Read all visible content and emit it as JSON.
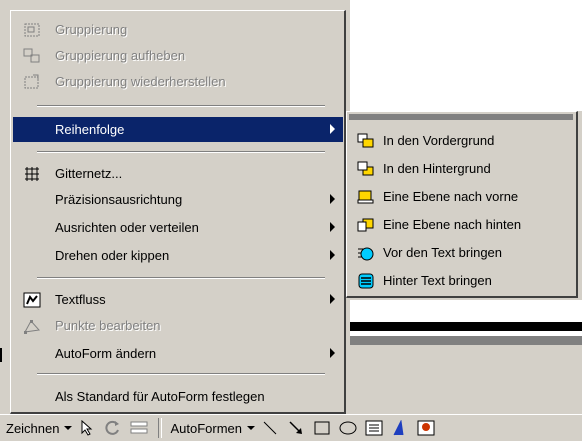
{
  "menu": {
    "items": [
      {
        "label": "Gruppierung",
        "icon": "group-icon",
        "disabled": true
      },
      {
        "label": "Gruppierung aufheben",
        "icon": "ungroup-icon",
        "disabled": true
      },
      {
        "label": "Gruppierung wiederherstellen",
        "icon": "regroup-icon",
        "disabled": true
      },
      {
        "label": "Reihenfolge",
        "selected": true,
        "submenu": true
      },
      {
        "label": "Gitternetz...",
        "icon": "grid-icon"
      },
      {
        "label": "Präzisionsausrichtung",
        "submenu": true
      },
      {
        "label": "Ausrichten oder verteilen",
        "submenu": true
      },
      {
        "label": "Drehen oder kippen",
        "submenu": true
      },
      {
        "label": "Textfluss",
        "icon": "text-wrap-icon",
        "submenu": true
      },
      {
        "label": "Punkte bearbeiten",
        "icon": "edit-points-icon",
        "disabled": true
      },
      {
        "label": "AutoForm ändern",
        "submenu": true
      },
      {
        "label": "Als Standard für AutoForm festlegen"
      }
    ]
  },
  "submenu": {
    "items": [
      {
        "label": "In den Vordergrund",
        "icon": "bring-to-front-icon"
      },
      {
        "label": "In den Hintergrund",
        "icon": "send-to-back-icon"
      },
      {
        "label": "Eine Ebene nach vorne",
        "icon": "bring-forward-icon"
      },
      {
        "label": "Eine Ebene nach hinten",
        "icon": "send-backward-icon"
      },
      {
        "label": "Vor den Text bringen",
        "icon": "bring-in-front-of-text-icon"
      },
      {
        "label": "Hinter Text bringen",
        "icon": "send-behind-text-icon"
      }
    ]
  },
  "toolbar": {
    "zeichnen": "Zeichnen",
    "autoformen": "AutoFormen"
  },
  "colors": {
    "highlight": "#0a246a",
    "menu_bg": "#d4d0c8",
    "disabled": "#808080"
  }
}
